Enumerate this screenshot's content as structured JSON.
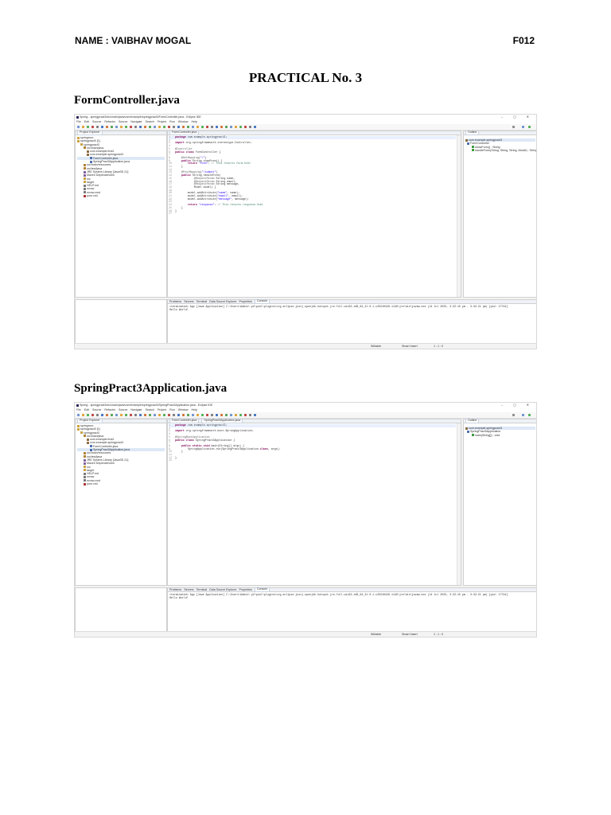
{
  "header": {
    "name": "NAME : VAIBHAV MOGAL",
    "roll": "F012"
  },
  "title": "PRACTICAL No. 3",
  "sections": [
    {
      "title": "FormController.java",
      "window_title": "Spring - springpract3/src/main/java/com/example/springpract3/FormController.java - Eclipse IDE",
      "menu": [
        "File",
        "Edit",
        "Source",
        "Refactor",
        "Source",
        "Navigate",
        "Search",
        "Project",
        "Run",
        "Window",
        "Help"
      ],
      "explorer_tab": "Project Explorer",
      "tree": [
        "springmvc",
        "springpract3 [1]",
        "springpract3",
        "src/main/java",
        "com.example.fma2",
        "com.example.springpract3",
        "FormController.java",
        "SpringPract3Application.java",
        "src/main/resources",
        "src/test/java",
        "JRE System Library [JavaSE-21]",
        "Maven Dependencies",
        "src",
        "target",
        "HELP.md",
        "mvnw",
        "mvnw.cmd",
        "pom.xml"
      ],
      "editor_tabs": [
        "FormController.java"
      ],
      "code": [
        {
          "n": "1",
          "t": "package com.example.springpract3;"
        },
        {
          "n": "2",
          "t": ""
        },
        {
          "n": "3",
          "t": "import org.springframework.stereotype.Controller;"
        },
        {
          "n": "4",
          "t": ""
        },
        {
          "n": "5",
          "t": "@Controller"
        },
        {
          "n": "6",
          "t": "public class FormController {"
        },
        {
          "n": "7",
          "t": ""
        },
        {
          "n": "8",
          "t": "    @GetMapping(\"/\")"
        },
        {
          "n": "9",
          "t": "    public String showForm() {"
        },
        {
          "n": "10",
          "t": "        return \"form\"; // This returns form.html"
        },
        {
          "n": "11",
          "t": "    }"
        },
        {
          "n": "12",
          "t": ""
        },
        {
          "n": "13",
          "t": "    @PostMapping(\"/submit\")"
        },
        {
          "n": "14",
          "t": "    public String handleForm("
        },
        {
          "n": "15",
          "t": "            @RequestParam String name,"
        },
        {
          "n": "16",
          "t": "            @RequestParam String email,"
        },
        {
          "n": "17",
          "t": "            @RequestParam String message,"
        },
        {
          "n": "18",
          "t": "            Model model) {"
        },
        {
          "n": "19",
          "t": ""
        },
        {
          "n": "20",
          "t": "        model.addAttribute(\"name\", name);"
        },
        {
          "n": "21",
          "t": "        model.addAttribute(\"email\", email);"
        },
        {
          "n": "22",
          "t": "        model.addAttribute(\"message\", message);"
        },
        {
          "n": "23",
          "t": ""
        },
        {
          "n": "24",
          "t": "        return \"response\"; // This returns response.html"
        },
        {
          "n": "25",
          "t": "    }"
        },
        {
          "n": "26",
          "t": "}"
        },
        {
          "n": "27",
          "t": ""
        }
      ],
      "outline_tab": "Outline",
      "outline": [
        "com.example.springpract3",
        "FormController",
        "showForm() : String",
        "handleForm(String, String, String, Model) : String"
      ],
      "console_tabs": [
        "Problems",
        "Servers",
        "Terminal",
        "Data Source Explorer",
        "Properties",
        "Console"
      ],
      "console_line1": "<terminated> App [Java Application] C:\\Users\\Admin\\.p2\\pool\\plugins\\org.eclipse.justj.openjdk.hotspot.jre.full.win32.x86_64_21.0.1.v20240426-1149\\jre\\bin\\javaw.exe (14 Jul 2025, 3:32:15 pm - 3:32:21 pm) [pid: 17744]",
      "console_line2": "Hello World!",
      "status": [
        "Writable",
        "Smart Insert",
        "1 : 1 : 0"
      ]
    },
    {
      "title": "SpringPract3Application.java",
      "window_title": "Spring - springpract3/src/main/java/com/example/springpract3/SpringPract3Application.java - Eclipse IDE",
      "menu": [
        "File",
        "Edit",
        "Source",
        "Refactor",
        "Source",
        "Navigate",
        "Search",
        "Project",
        "Run",
        "Window",
        "Help"
      ],
      "explorer_tab": "Project Explorer",
      "tree": [
        "springmvc",
        "springpract3 [1]",
        "springpract3",
        "src/main/java",
        "com.example.fma2",
        "com.example.springpract3",
        "FormController.java",
        "SpringPract3Application.java",
        "src/main/resources",
        "src/test/java",
        "JRE System Library [JavaSE-21]",
        "Maven Dependencies",
        "src",
        "target",
        "HELP.md",
        "mvnw",
        "mvnw.cmd",
        "pom.xml"
      ],
      "editor_tabs": [
        "FormController.java",
        "SpringPract3Application.java"
      ],
      "code": [
        {
          "n": "1",
          "t": "package com.example.springpract3;"
        },
        {
          "n": "2",
          "t": ""
        },
        {
          "n": "3",
          "t": "import org.springframework.boot.SpringApplication;"
        },
        {
          "n": "4",
          "t": ""
        },
        {
          "n": "5",
          "t": "@SpringBootApplication"
        },
        {
          "n": "6",
          "t": "public class SpringPract3Application {"
        },
        {
          "n": "7",
          "t": ""
        },
        {
          "n": "8",
          "t": "    public static void main(String[] args) {"
        },
        {
          "n": "9",
          "t": "        SpringApplication.run(SpringPract3Application.class, args);"
        },
        {
          "n": "10",
          "t": "    }"
        },
        {
          "n": "11",
          "t": ""
        },
        {
          "n": "12",
          "t": "}"
        },
        {
          "n": "13",
          "t": ""
        }
      ],
      "outline_tab": "Outline",
      "outline": [
        "com.example.springpract3",
        "SpringPract3Application",
        "main(String[]) : void"
      ],
      "console_tabs": [
        "Problems",
        "Servers",
        "Terminal",
        "Data Source Explorer",
        "Properties",
        "Console"
      ],
      "console_line1": "<terminated> App [Java Application] C:\\Users\\Admin\\.p2\\pool\\plugins\\org.eclipse.justj.openjdk.hotspot.jre.full.win32.x86_64_21.0.1.v20240426-1149\\jre\\bin\\javaw.exe (14 Jul 2025, 3:32:15 pm - 3:32:21 pm) [pid: 17744]",
      "console_line2": "Hello World!",
      "status": [
        "Writable",
        "Smart Insert",
        "1 : 1 : 0"
      ]
    }
  ]
}
